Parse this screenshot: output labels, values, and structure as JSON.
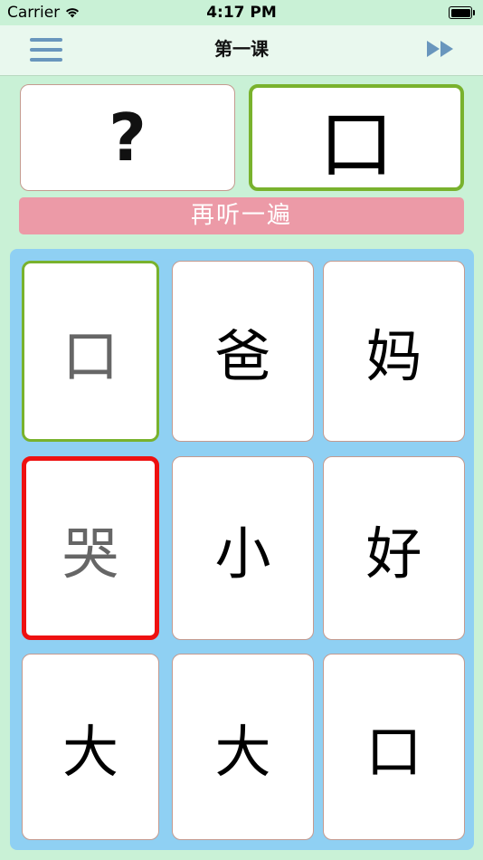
{
  "status_bar": {
    "carrier": "Carrier",
    "time": "4:17 PM",
    "wifi_icon": "wifi-icon",
    "battery_icon": "battery-icon"
  },
  "nav": {
    "title": "第一课",
    "menu_icon": "menu-icon",
    "skip_icon": "fast-forward-icon"
  },
  "prompt": {
    "question": "?",
    "answer": "口"
  },
  "replay_label": "再听一遍",
  "colors": {
    "background": "#c9f1d6",
    "grid_background": "#8fd0f3",
    "replay_button": "#ec9aa7",
    "correct_border": "#79b22d",
    "wrong_border": "#ee1111",
    "icon_blue": "#6996bd"
  },
  "tiles": [
    {
      "char": "口",
      "state": "correct"
    },
    {
      "char": "爸",
      "state": "normal"
    },
    {
      "char": "妈",
      "state": "normal"
    },
    {
      "char": "哭",
      "state": "wrong"
    },
    {
      "char": "小",
      "state": "normal"
    },
    {
      "char": "好",
      "state": "normal"
    },
    {
      "char": "大",
      "state": "normal"
    },
    {
      "char": "大",
      "state": "normal"
    },
    {
      "char": "口",
      "state": "normal"
    }
  ]
}
